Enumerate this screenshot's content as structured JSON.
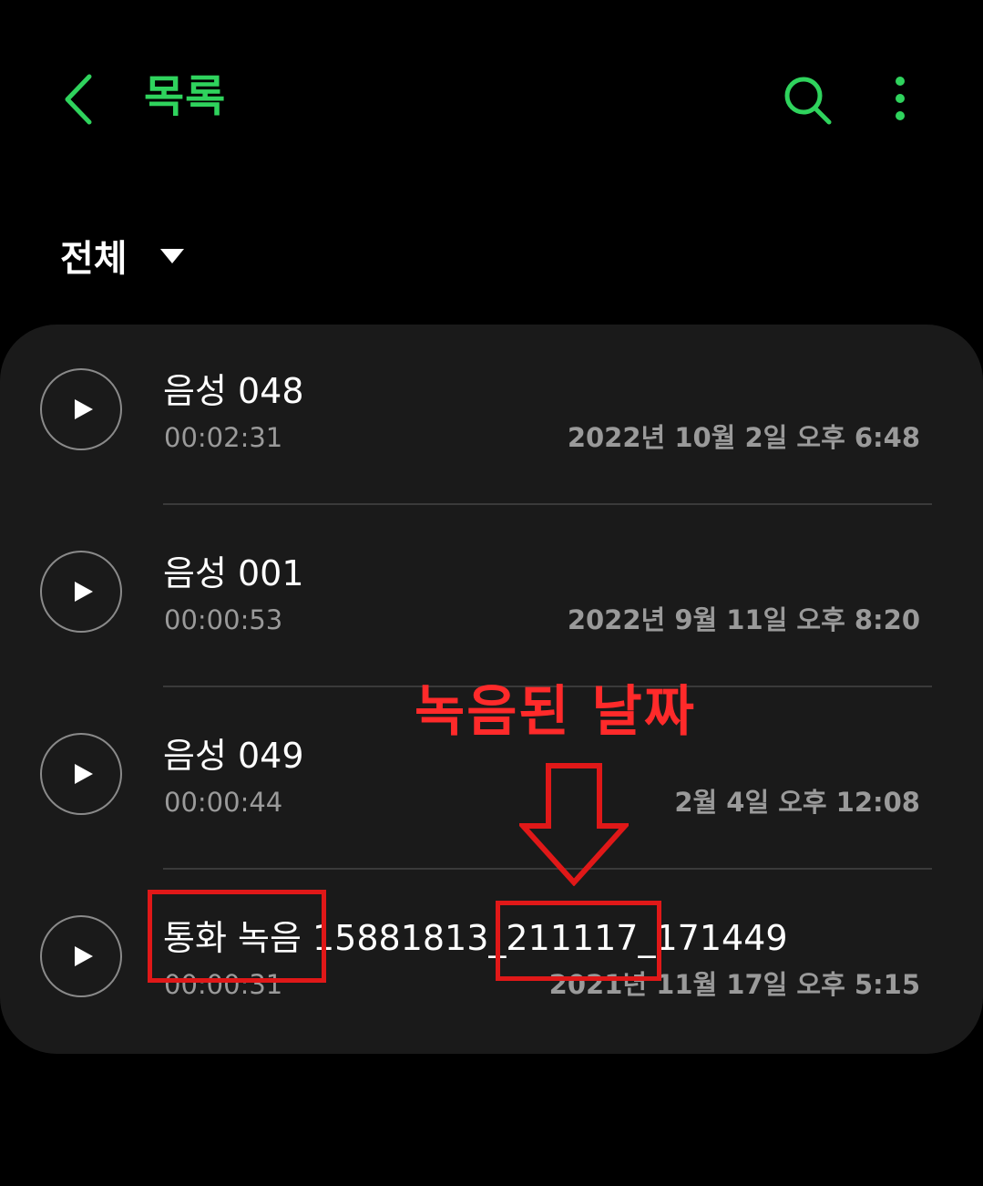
{
  "header": {
    "title": "목록",
    "back_icon": "chevron-left-icon",
    "search_icon": "search-icon",
    "more_icon": "more-vertical-icon",
    "accent_color": "#2fd35d"
  },
  "filter": {
    "label": "전체",
    "caret_icon": "caret-down-icon"
  },
  "recordings": [
    {
      "title": "음성 048",
      "duration": "00:02:31",
      "date": "2022년 10월 2일 오후 6:48"
    },
    {
      "title": "음성 001",
      "duration": "00:00:53",
      "date": "2022년 9월 11일 오후 8:20"
    },
    {
      "title": "음성 049",
      "duration": "00:00:44",
      "date": "2월 4일 오후 12:08"
    },
    {
      "title": "통화 녹음 15881813_211117_171449",
      "duration": "00:00:31",
      "date": "2021년 11월 17일 오후 5:15"
    }
  ],
  "annotation": {
    "text": "녹음된 날짜",
    "color": "#ff2a2a",
    "arrow_icon": "arrow-down-outline-icon"
  }
}
